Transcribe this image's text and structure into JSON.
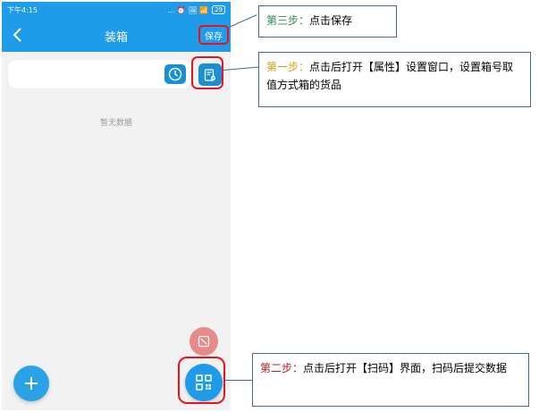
{
  "status_bar": {
    "time": "下午4:15",
    "icons": "... ⏰ 🖼 📶",
    "battery": "29"
  },
  "nav": {
    "title": "装箱",
    "save_label": "保存"
  },
  "content": {
    "empty_text": "暂无数据"
  },
  "callouts": {
    "step3": {
      "label": "第三步：",
      "text": "点击保存"
    },
    "step1": {
      "label": "第一步：",
      "text": "点击后打开【属性】设置窗口，设置箱号取值方式箱的货品"
    },
    "step2": {
      "label": "第二步：",
      "text": "点击后打开【扫码】界面，扫码后提交数据"
    }
  },
  "colors": {
    "primary": "#1e9be9",
    "highlight": "#e8141a",
    "step3": "#2e8b57",
    "step1": "#d4a017",
    "step2": "#b22222"
  }
}
